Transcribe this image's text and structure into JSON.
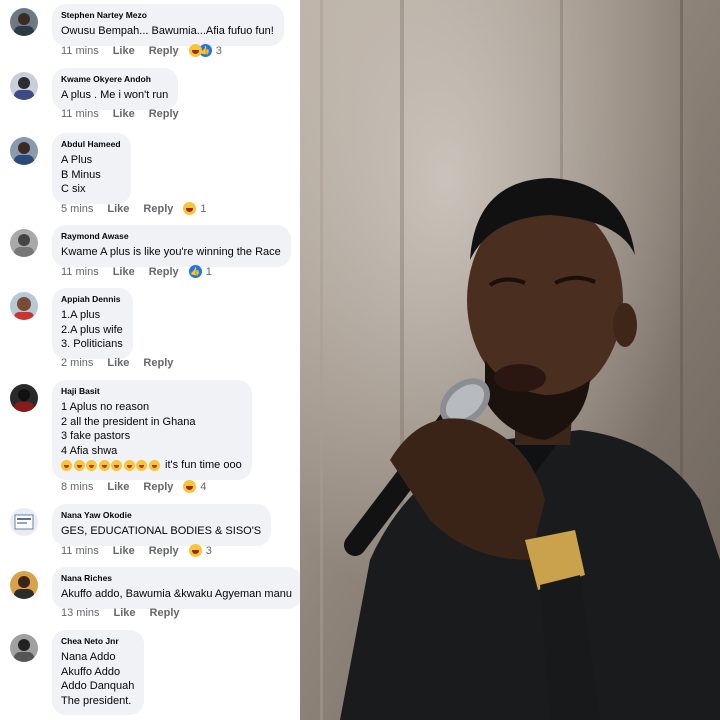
{
  "comments": [
    {
      "author": "Stephen Nartey Mezo",
      "lines": [
        "Owusu Bempah... Bawumia...Afia fufuo fun!"
      ],
      "time": "11 mins",
      "like": "Like",
      "reply": "Reply",
      "reactions": [
        "haha-icon",
        "like-icon"
      ],
      "reaction_count": "3"
    },
    {
      "author": "Kwame Okyere Andoh",
      "lines": [
        "A plus . Me i won't run"
      ],
      "time": "11 mins",
      "like": "Like",
      "reply": "Reply",
      "reactions": [],
      "reaction_count": ""
    },
    {
      "author": "Abdul Hameed",
      "lines": [
        "A Plus",
        "B Minus",
        "C six"
      ],
      "time": "5 mins",
      "like": "Like",
      "reply": "Reply",
      "reactions": [
        "haha-icon"
      ],
      "reaction_count": "1"
    },
    {
      "author": "Raymond Awase",
      "lines": [
        "Kwame A plus is like you're winning the Race"
      ],
      "time": "11 mins",
      "like": "Like",
      "reply": "Reply",
      "reactions": [
        "like-icon"
      ],
      "reaction_count": "1"
    },
    {
      "author": "Appiah Dennis",
      "lines": [
        "1.A plus",
        "2.A plus wife",
        "3. Politicians"
      ],
      "time": "2 mins",
      "like": "Like",
      "reply": "Reply",
      "reactions": [],
      "reaction_count": ""
    },
    {
      "author": "Haji Basit",
      "lines": [
        "1 Aplus no reason",
        "2 all the president in Ghana",
        "3 fake pastors",
        "4 Afia shwa"
      ],
      "emoji_line": {
        "emoji_count": 8,
        "text": "it's fun time ooo"
      },
      "time": "8 mins",
      "like": "Like",
      "reply": "Reply",
      "reactions": [
        "haha-icon"
      ],
      "reaction_count": "4"
    },
    {
      "author": "Nana Yaw Okodie",
      "lines": [
        "GES, EDUCATIONAL BODIES & SISO'S"
      ],
      "time": "11 mins",
      "like": "Like",
      "reply": "Reply",
      "reactions": [
        "haha-icon"
      ],
      "reaction_count": "3"
    },
    {
      "author": "Nana Riches",
      "lines": [
        "Akuffo addo, Bawumia &kwaku Agyeman manu"
      ],
      "time": "13 mins",
      "like": "Like",
      "reply": "Reply",
      "reactions": [],
      "reaction_count": ""
    },
    {
      "author": "Chea Neto Jnr",
      "lines": [
        "Nana Addo",
        "Akuffo Addo",
        "Addo Danquah",
        "The president."
      ],
      "time": "",
      "like": "",
      "reply": "",
      "reactions": [],
      "reaction_count": ""
    }
  ],
  "photo": {
    "icon": "photo-of-man-singing-into-microphone"
  },
  "colors": {
    "bubble": "#f0f2f5",
    "meta": "#65676b",
    "like_blue": "#1877f2",
    "haha_yellow": "#f7c537"
  }
}
